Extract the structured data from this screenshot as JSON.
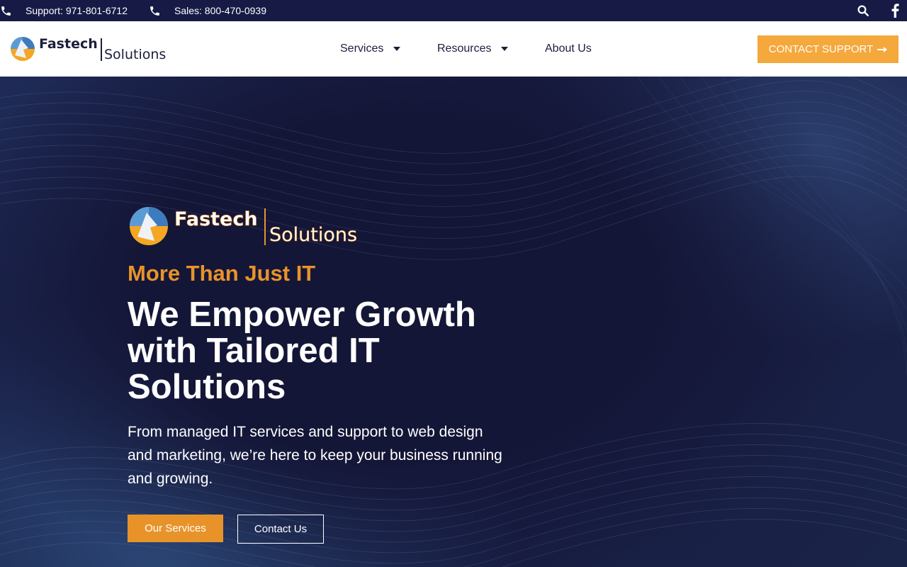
{
  "topbar": {
    "support": "Support: 971-801-6712",
    "sales": "Sales: 800-470-0939"
  },
  "brand": {
    "name_top": "Fastech",
    "name_bottom": "Solutions"
  },
  "nav": {
    "services": "Services",
    "resources": "Resources",
    "about": "About Us"
  },
  "cta": {
    "label": "Contact Support"
  },
  "hero": {
    "tagline": "More Than Just IT",
    "headline": "We Empower Growth with Tailored IT Solutions",
    "subtext": "From managed IT services and support to web design and marketing, we’re here to keep your business running and growing.",
    "primary_button": "Our Services",
    "secondary_button": "Contact Us"
  },
  "colors": {
    "topbar_bg": "#161a45",
    "accent_orange": "#e8932a",
    "cta_orange": "#f5a83c",
    "hero_bg": "#141637"
  },
  "icons": [
    "phone-icon",
    "search-icon",
    "facebook-icon",
    "caret-down-icon",
    "arrow-right-icon"
  ]
}
